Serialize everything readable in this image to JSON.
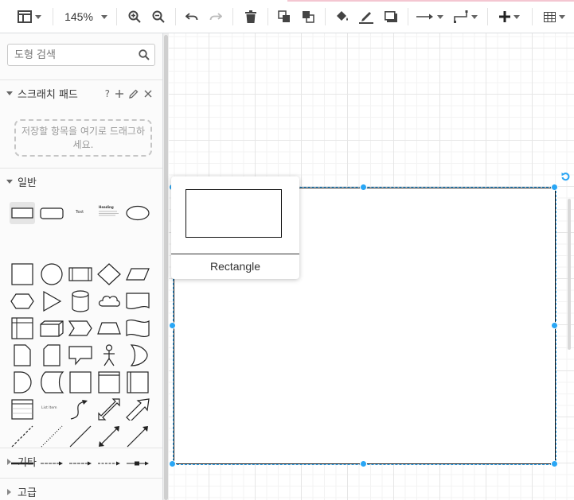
{
  "toolbar": {
    "zoom_level": "145%"
  },
  "sidebar": {
    "search": {
      "placeholder": "도형 검색",
      "value": ""
    },
    "scratchpad": {
      "title": "스크래치 패드",
      "help_label": "?",
      "dropzone_text": "저장할 항목을 여기로 드래그하세요."
    },
    "sections": [
      {
        "label": "일반",
        "expanded": true
      },
      {
        "label": "기타",
        "expanded": false
      },
      {
        "label": "고급",
        "expanded": false
      }
    ],
    "general_shapes": [
      "rectangle",
      "rounded-rectangle",
      "text",
      "textbox",
      "ellipse",
      "square",
      "circle",
      "process",
      "diamond",
      "parallelogram",
      "hexagon",
      "triangle",
      "cylinder",
      "cloud",
      "document",
      "internal-storage",
      "cube",
      "step",
      "trapezoid",
      "tape",
      "note",
      "card",
      "callout",
      "actor",
      "or",
      "and",
      "data-storage",
      "square-2",
      "container",
      "vertical-container",
      "table-list",
      "list-item",
      "curve",
      "bidirectional-arrow",
      "arrow",
      "dashed-line",
      "dotted-line",
      "line",
      "bidirectional-connector",
      "directional-connector",
      "thick-line",
      "link-arrow",
      "link-arrow-2",
      "dashed-link",
      "connector-with-box"
    ],
    "mini_text": {
      "text": "Text",
      "heading": "Heading",
      "list_item": "List Item"
    }
  },
  "canvas": {
    "tooltip": {
      "label": "Rectangle"
    }
  },
  "colors": {
    "selection": "#29a6f5",
    "grid_major": "#e6e6e6",
    "grid_minor": "#f3f3f3"
  }
}
